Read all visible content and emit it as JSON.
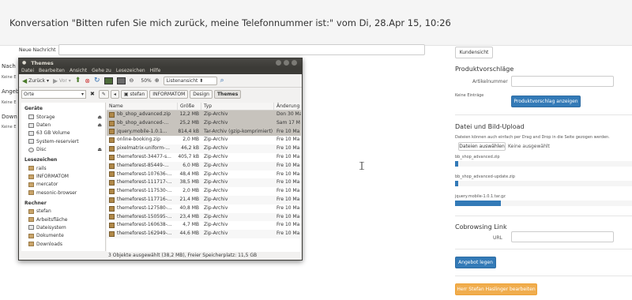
{
  "header": {
    "title": "Konversation  \"Bitten rufen Sie mich zurück, meine Telefonnummer ist:\" vom Di, 28.Apr 15, 10:26"
  },
  "new_message": {
    "label": "Neue Nachricht",
    "value": ""
  },
  "left_sections": [
    {
      "title": "Nach",
      "sub": "Keine E"
    },
    {
      "title": "Angeb",
      "sub": "Keine E"
    },
    {
      "title": "Down",
      "sub": "Keine E"
    }
  ],
  "right": {
    "kundensicht": "Kundensicht",
    "produktvorschlaege": {
      "title": "Produktvorschläge",
      "artikelnummer_label": "Artikelnummer",
      "artikelnummer_value": "",
      "empty": "Keine Einträge",
      "button": "Produktvorschlag anzeigen"
    },
    "upload": {
      "title": "Datei und Bild-Upload",
      "hint": "Dateien können auch einfach per Drag and Drop in die Seite gezogen werden.",
      "choose_button": "Dateien auswählen",
      "choose_status": "Keine ausgewählt",
      "files": [
        {
          "name": "bb_shop_advanced.zip",
          "progress": 0.02
        },
        {
          "name": "bb_shop_advanced-update.zip",
          "progress": 0.02
        },
        {
          "name": "jquery.mobile-1.0.1.tar.gz",
          "progress": 0.26
        }
      ]
    },
    "cobrowsing": {
      "title": "Cobrowsing Link",
      "url_label": "URL",
      "url_value": ""
    },
    "angebot_button": "Angebot legen",
    "edit_button": "Herr Stefan Haslinger bearbeiten"
  },
  "filemanager": {
    "title": "Themes",
    "menu": [
      "Datei",
      "Bearbeiten",
      "Ansicht",
      "Gehe zu",
      "Lesezeichen",
      "Hilfe"
    ],
    "toolbar": {
      "back": "Zurück",
      "forward": "Vor",
      "zoom": "50%",
      "view": "Listenansicht"
    },
    "location": {
      "placeholder": "Orte",
      "crumbs": [
        "stefan",
        "INFORMATOM",
        "Design",
        "Themes"
      ]
    },
    "sidebar": [
      {
        "header": "Geräte",
        "items": [
          {
            "label": "Storage",
            "icon": "disk-icon",
            "eject": true
          },
          {
            "label": "Daten",
            "icon": "disk-icon",
            "eject": true
          },
          {
            "label": "63 GB Volume",
            "icon": "disk-icon",
            "eject": false
          },
          {
            "label": "System-reserviert",
            "icon": "disk-icon",
            "eject": false
          },
          {
            "label": "Disc",
            "icon": "disc-icon",
            "eject": true
          }
        ]
      },
      {
        "header": "Lesezeichen",
        "items": [
          {
            "label": "rails",
            "icon": "folder-icon",
            "eject": false
          },
          {
            "label": "INFORMATOM",
            "icon": "folder-icon",
            "eject": false
          },
          {
            "label": "mercator",
            "icon": "folder-icon",
            "eject": false
          },
          {
            "label": "mesonic-browser",
            "icon": "folder-icon",
            "eject": false
          }
        ]
      },
      {
        "header": "Rechner",
        "items": [
          {
            "label": "stefan",
            "icon": "home-icon",
            "eject": false
          },
          {
            "label": "Arbeitsfläche",
            "icon": "folder-icon",
            "eject": false
          },
          {
            "label": "Dateisystem",
            "icon": "disk-icon",
            "eject": false
          },
          {
            "label": "Dokumente",
            "icon": "folder-icon",
            "eject": false
          },
          {
            "label": "Downloads",
            "icon": "folder-icon",
            "eject": false
          }
        ]
      }
    ],
    "columns": [
      "Name",
      "Größe",
      "Typ",
      "Änderung"
    ],
    "files": [
      {
        "name": "bb_shop_advanced.zip",
        "size": "12,2 MB",
        "type": "Zip-Archiv",
        "date": "Don 30 Ma",
        "selected": true
      },
      {
        "name": "bb_shop_advanced-...",
        "size": "25,2 MB",
        "type": "Zip-Archiv",
        "date": "Sam 17 M",
        "selected": true
      },
      {
        "name": "jquery.mobile-1.0.1...",
        "size": "814,4 kB",
        "type": "Tar-Archiv (gzip-komprimiert)",
        "date": "Fre 10 Ma",
        "selected": true
      },
      {
        "name": "online-booking.zip",
        "size": "2,0 MB",
        "type": "Zip-Archiv",
        "date": "Fre 10 Ma",
        "selected": false
      },
      {
        "name": "pixelmatrix-uniform-...",
        "size": "46,2 kB",
        "type": "Zip-Archiv",
        "date": "Fre 10 Ma",
        "selected": false
      },
      {
        "name": "themeforest-34477-s...",
        "size": "405,7 kB",
        "type": "Zip-Archiv",
        "date": "Fre 10 Ma",
        "selected": false
      },
      {
        "name": "themeforest-85449-...",
        "size": "6,0 MB",
        "type": "Zip-Archiv",
        "date": "Fre 10 Ma",
        "selected": false
      },
      {
        "name": "themeforest-107636-...",
        "size": "48,4 MB",
        "type": "Zip-Archiv",
        "date": "Fre 10 Ma",
        "selected": false
      },
      {
        "name": "themeforest-111717-...",
        "size": "38,5 MB",
        "type": "Zip-Archiv",
        "date": "Fre 10 Ma",
        "selected": false
      },
      {
        "name": "themeforest-117530-...",
        "size": "2,0 MB",
        "type": "Zip-Archiv",
        "date": "Fre 10 Ma",
        "selected": false
      },
      {
        "name": "themeforest-117716-...",
        "size": "21,4 MB",
        "type": "Zip-Archiv",
        "date": "Fre 10 Ma",
        "selected": false
      },
      {
        "name": "themeforest-127580-...",
        "size": "40,8 MB",
        "type": "Zip-Archiv",
        "date": "Fre 10 Ma",
        "selected": false
      },
      {
        "name": "themeforest-150595-...",
        "size": "23,4 MB",
        "type": "Zip-Archiv",
        "date": "Fre 10 Ma",
        "selected": false
      },
      {
        "name": "themeforest-160638-...",
        "size": "4,7 MB",
        "type": "Zip-Archiv",
        "date": "Fre 10 Ma",
        "selected": false
      },
      {
        "name": "themeforest-162949-...",
        "size": "44,6 MB",
        "type": "Zip-Archiv",
        "date": "Fre 10 Ma",
        "selected": false
      }
    ],
    "status": "3 Objekte ausgewählt (38,2 MB), Freier Speicherplatz: 11,5 GB"
  }
}
